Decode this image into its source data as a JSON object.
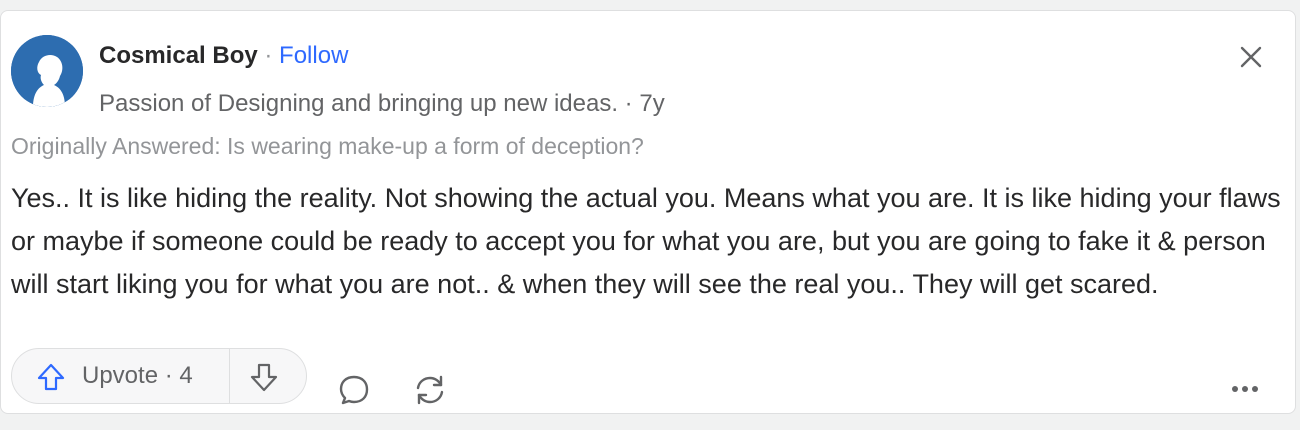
{
  "author": {
    "name": "Cosmical Boy",
    "separator": " · ",
    "follow_label": "Follow",
    "credential": "Passion of Designing and bringing up new ideas.",
    "age_separator": " · ",
    "age": "7y"
  },
  "post": {
    "originally_answered": "Originally Answered: Is wearing make-up a form of deception?",
    "body": "Yes.. It is like hiding the reality. Not showing the actual you. Means what you are. It is like hiding your flaws or maybe if someone could be ready to accept you for what you are, but you are going to fake it & person will start liking you for what you are not.. & when they will see the real you.. They will get scared."
  },
  "actions": {
    "upvote_label": "Upvote",
    "upvote_separator": " · ",
    "upvote_count": "4"
  },
  "icons": {
    "avatar": "avatar-silhouette",
    "close": "close-icon",
    "upvote": "upvote-arrow-icon",
    "downvote": "downvote-arrow-icon",
    "comment": "comment-bubble-icon",
    "share": "share-cycle-icon",
    "more": "more-dots-icon"
  },
  "colors": {
    "link": "#2e69ff",
    "text": "#282829",
    "muted": "#939598",
    "avatar_bg": "#2d6db0"
  }
}
